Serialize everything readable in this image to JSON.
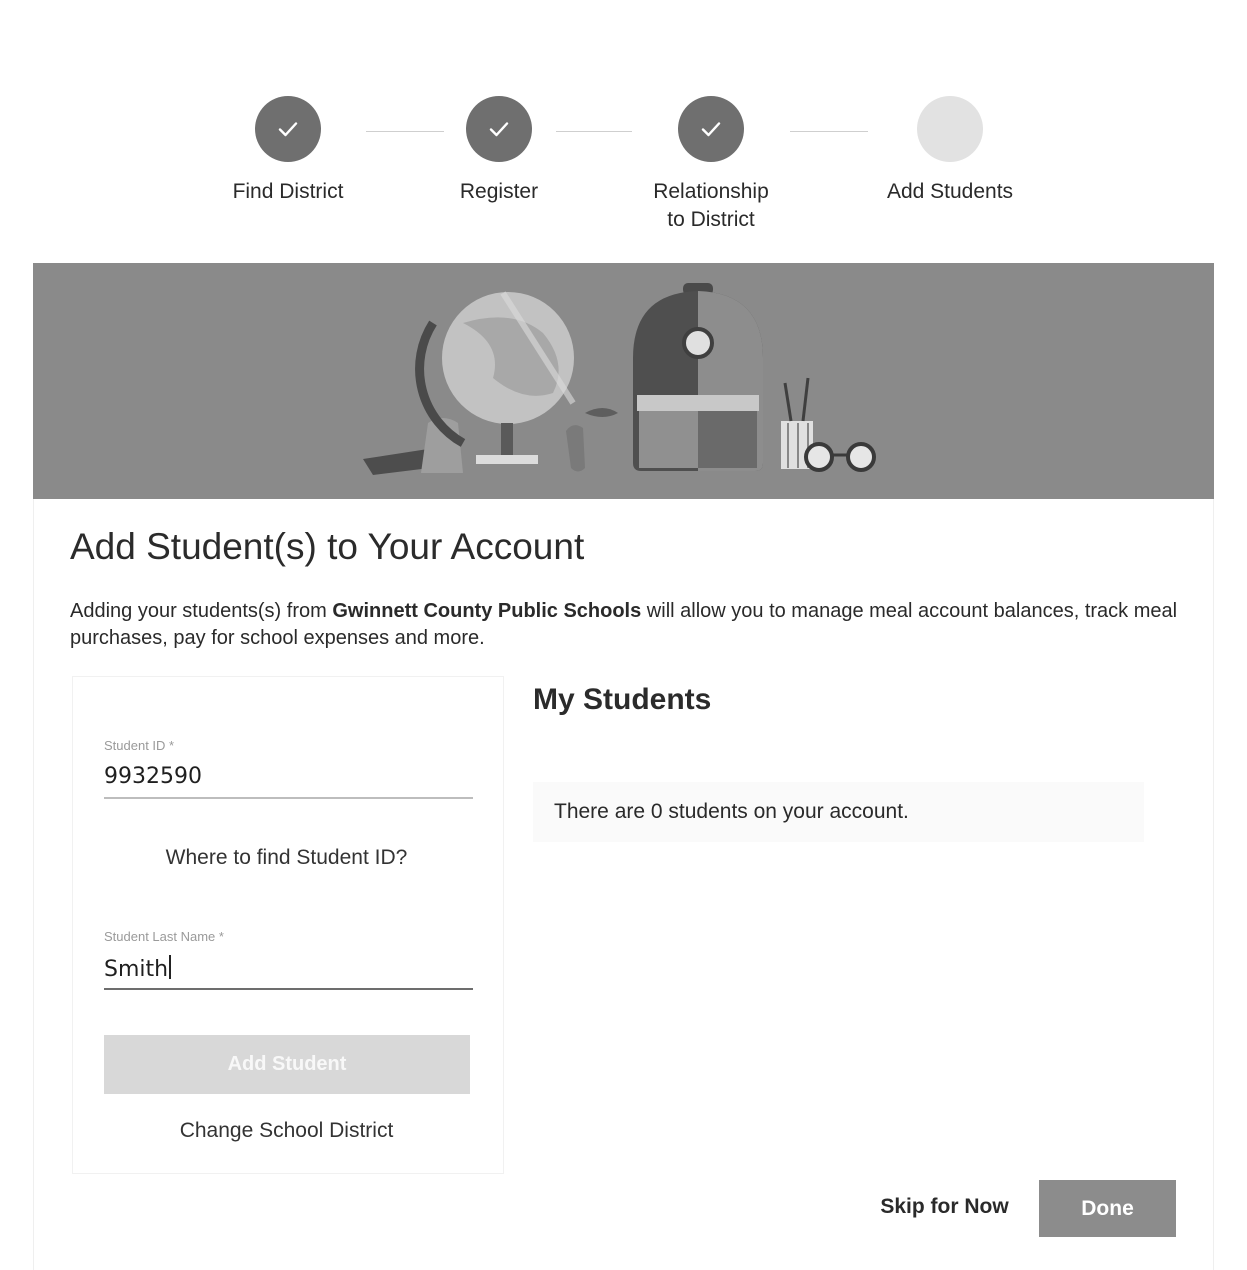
{
  "stepper": {
    "steps": [
      {
        "label": "Find District",
        "status": "done"
      },
      {
        "label": "Register",
        "status": "done"
      },
      {
        "label": "Relationship to District",
        "label_line1": "Relationship",
        "label_line2": "to District",
        "status": "done"
      },
      {
        "label": "Add Students",
        "status": "pending"
      }
    ]
  },
  "main": {
    "title": "Add Student(s) to Your Account",
    "intro_prefix": "Adding your students(s) from ",
    "district_name": "Gwinnett County Public Schools",
    "intro_suffix": " will allow you to manage meal account balances, track meal purchases, pay for school expenses and more."
  },
  "form": {
    "student_id_label": "Student ID *",
    "student_id_value": "9932590",
    "find_id_link": "Where to find Student ID?",
    "last_name_label": "Student Last Name *",
    "last_name_value": "Smith",
    "add_button_label": "Add Student",
    "change_district_link": "Change School District"
  },
  "students": {
    "title": "My Students",
    "empty_message": "There are 0 students on your account."
  },
  "footer": {
    "skip_label": "Skip for Now",
    "done_label": "Done"
  },
  "colors": {
    "step_done": "#6f6f6f",
    "step_pending": "#e2e2e2",
    "banner": "#8a8a8a",
    "button_disabled": "#d8d8d8",
    "done_button": "#8c8c8c"
  }
}
